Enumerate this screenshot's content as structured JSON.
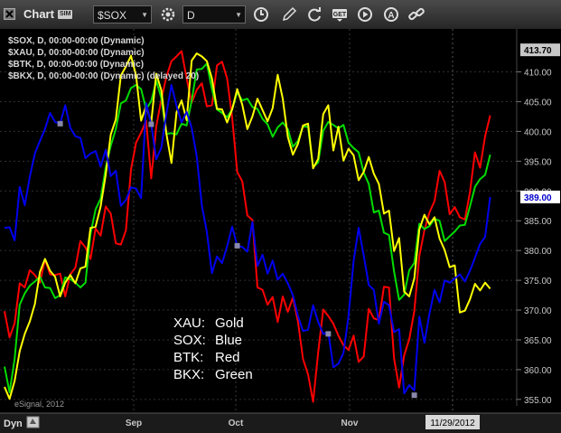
{
  "toolbar": {
    "title": "Chart",
    "sim_badge": "SIM",
    "symbol": "$SOX",
    "interval": "D",
    "icons": [
      "settings-icon",
      "clock-icon",
      "pencil-icon",
      "refresh-icon",
      "get-icon",
      "play-icon",
      "a-icon",
      "link-icon"
    ]
  },
  "legend": [
    "$SOX, D, 00:00-00:00 (Dynamic)",
    "$XAU, D, 00:00-00:00 (Dynamic)",
    "$BTK, D, 00:00-00:00 (Dynamic)",
    "$BKX, D, 00:00-00:00 (Dynamic) (delayed 20)"
  ],
  "key": [
    {
      "label": "XAU:",
      "value": "Gold"
    },
    {
      "label": "SOX:",
      "value": "Blue"
    },
    {
      "label": "BTK:",
      "value": "Red"
    },
    {
      "label": "BKX:",
      "value": "Green"
    }
  ],
  "footer": {
    "watermark": "eSignal, 2012",
    "dyn": "Dyn",
    "date_marker": "11/29/2012"
  },
  "colors": {
    "xau": "#ffff00",
    "sox": "#0000ee",
    "btk": "#ff0000",
    "bkx": "#00dd00",
    "background": "#000000"
  },
  "chart_data": {
    "type": "line",
    "ylim": [
      353,
      416
    ],
    "y_ticks": [
      355,
      360,
      365,
      370,
      375,
      380,
      385,
      390,
      395,
      400,
      405,
      410
    ],
    "y_tick_labels": [
      "355.00",
      "360.00",
      "365.00",
      "370.00",
      "375.00",
      "380.00",
      "385.00",
      "390.00",
      "395.00",
      "400.00",
      "405.00",
      "410.00"
    ],
    "x_labels": [
      "Sep",
      "Oct",
      "Nov"
    ],
    "price_labels": [
      {
        "text": "413.70",
        "value": 413.7,
        "series": "top"
      },
      {
        "text": "389.00",
        "value": 389.0,
        "series": "SOX"
      }
    ],
    "markers": [
      {
        "series": "SOX",
        "index": 11,
        "value": 401.3
      },
      {
        "series": "SOX",
        "index": 29,
        "value": 401.2
      },
      {
        "series": "SOX",
        "index": 46,
        "value": 380.8
      },
      {
        "series": "SOX",
        "index": 64,
        "value": 366.0
      },
      {
        "series": "SOX",
        "index": 81,
        "value": 355.7
      }
    ],
    "series": [
      {
        "name": "SOX",
        "color": "#0000ee",
        "values": [
          383.8,
          383.9,
          381.7,
          390.7,
          387.6,
          392.4,
          396.3,
          398.4,
          400.4,
          403.1,
          401.6,
          401.3,
          404.4,
          400.6,
          399.2,
          398.9,
          395.5,
          396.3,
          396.7,
          394.1,
          396.9,
          392.5,
          393.4,
          387.5,
          388.5,
          390.6,
          390.4,
          388.8,
          404.7,
          401.2,
          395.3,
          397.3,
          403.0,
          407.8,
          404.3,
          401.5,
          403.3,
          400.6,
          395.8,
          387.6,
          383.1,
          376.2,
          379.0,
          377.9,
          380.7,
          384.0,
          380.8,
          380.6,
          379.8,
          384.8,
          377.4,
          379.3,
          376.1,
          378.3,
          375.1,
          376.1,
          374.5,
          372.5,
          369.0,
          366.5,
          366.7,
          370.8,
          368.0,
          366.0,
          366.3,
          360.4,
          361.0,
          362.8,
          369.0,
          378.2,
          383.8,
          379.2,
          374.2,
          373.4,
          367.7,
          371.4,
          370.8,
          366.3,
          366.8,
          356.0,
          357.4,
          356.5,
          368.9,
          364.5,
          369.4,
          373.4,
          371.3,
          375.0,
          374.6,
          375.3,
          376.0,
          374.8,
          376.6,
          378.8,
          381.1,
          382.3,
          389.0
        ]
      },
      {
        "name": "XAU",
        "color": "#ffff00",
        "values": [
          357.1,
          355.1,
          358.1,
          363.1,
          366.0,
          368.1,
          371.0,
          376.4,
          378.6,
          376.6,
          375.6,
          372.3,
          374.6,
          375.9,
          374.5,
          377.0,
          377.3,
          383.8,
          384.0,
          387.4,
          392.7,
          399.5,
          402.0,
          409.4,
          410.9,
          412.7,
          409.4,
          401.8,
          404.3,
          401.5,
          409.7,
          406.9,
          399.6,
          394.7,
          403.2,
          405.2,
          401.9,
          411.9,
          413.1,
          412.6,
          411.8,
          408.9,
          403.8,
          403.7,
          401.5,
          403.7,
          407.1,
          404.5,
          400.4,
          402.5,
          405.5,
          403.6,
          401.7,
          403.9,
          409.5,
          405.5,
          399.1,
          396.1,
          397.9,
          401.0,
          401.3,
          393.8,
          395.4,
          402.9,
          404.4,
          396.8,
          400.8,
          395.1,
          397.1,
          396.0,
          391.8,
          393.2,
          395.7,
          392.9,
          391.2,
          386.2,
          386.7,
          379.9,
          382.1,
          373.1,
          372.3,
          375.3,
          383.5,
          386.0,
          384.4,
          385.6,
          382.0,
          380.1,
          377.2,
          377.5,
          369.6,
          369.9,
          371.8,
          374.4,
          373.3,
          374.6,
          373.6
        ]
      },
      {
        "name": "BTK",
        "color": "#ff0000",
        "values": [
          369.8,
          365.4,
          367.8,
          374.5,
          373.8,
          376.7,
          375.9,
          374.6,
          378.5,
          376.0,
          375.9,
          376.1,
          372.3,
          376.0,
          377.1,
          381.6,
          380.5,
          378.6,
          383.7,
          382.5,
          387.4,
          386.2,
          381.2,
          381.0,
          383.4,
          393.6,
          398.1,
          399.8,
          401.8,
          392.1,
          400.9,
          405.4,
          409.2,
          411.8,
          412.6,
          413.5,
          408.9,
          404.8,
          407.0,
          408.1,
          404.2,
          404.4,
          411.1,
          411.7,
          408.9,
          402.3,
          393.2,
          391.6,
          385.9,
          385.1,
          373.8,
          373.4,
          370.9,
          372.2,
          368.0,
          372.3,
          369.7,
          372.1,
          368.1,
          361.8,
          359.2,
          354.6,
          362.9,
          370.1,
          369.0,
          367.7,
          365.7,
          364.1,
          363.3,
          365.7,
          361.3,
          362.2,
          370.2,
          368.6,
          368.3,
          373.9,
          373.8,
          361.9,
          357.0,
          362.4,
          365.1,
          369.8,
          379.1,
          383.4,
          386.4,
          388.3,
          393.4,
          391.5,
          386.1,
          387.3,
          385.6,
          385.2,
          389.8,
          396.5,
          393.9,
          399.2,
          402.7
        ]
      },
      {
        "name": "BKX",
        "color": "#00dd00",
        "values": [
          360.5,
          356.2,
          361.8,
          370.9,
          372.8,
          374.1,
          374.8,
          375.6,
          373.8,
          373.7,
          372.0,
          372.5,
          375.5,
          375.2,
          374.6,
          373.8,
          374.6,
          382.8,
          386.9,
          388.7,
          393.9,
          397.6,
          400.4,
          404.7,
          405.2,
          407.3,
          407.8,
          407.1,
          403.7,
          405.1,
          408.5,
          405.6,
          399.6,
          399.7,
          399.5,
          401.3,
          401.0,
          405.2,
          410.4,
          410.5,
          411.4,
          407.1,
          403.7,
          403.1,
          402.4,
          403.7,
          406.6,
          405.2,
          405.5,
          404.1,
          403.8,
          402.1,
          401.2,
          399.1,
          400.7,
          401.5,
          400.4,
          397.4,
          398.4,
          400.8,
          400.8,
          394.0,
          394.8,
          400.1,
          401.6,
          401.1,
          400.5,
          401.1,
          398.1,
          397.2,
          396.5,
          393.1,
          391.2,
          386.4,
          386.7,
          383.0,
          382.6,
          376.5,
          371.7,
          372.6,
          376.7,
          377.9,
          384.5,
          383.6,
          384.1,
          385.3,
          385.0,
          381.6,
          382.4,
          383.2,
          384.2,
          384.3,
          387.4,
          390.7,
          392.0,
          392.7,
          396.1
        ]
      }
    ]
  }
}
